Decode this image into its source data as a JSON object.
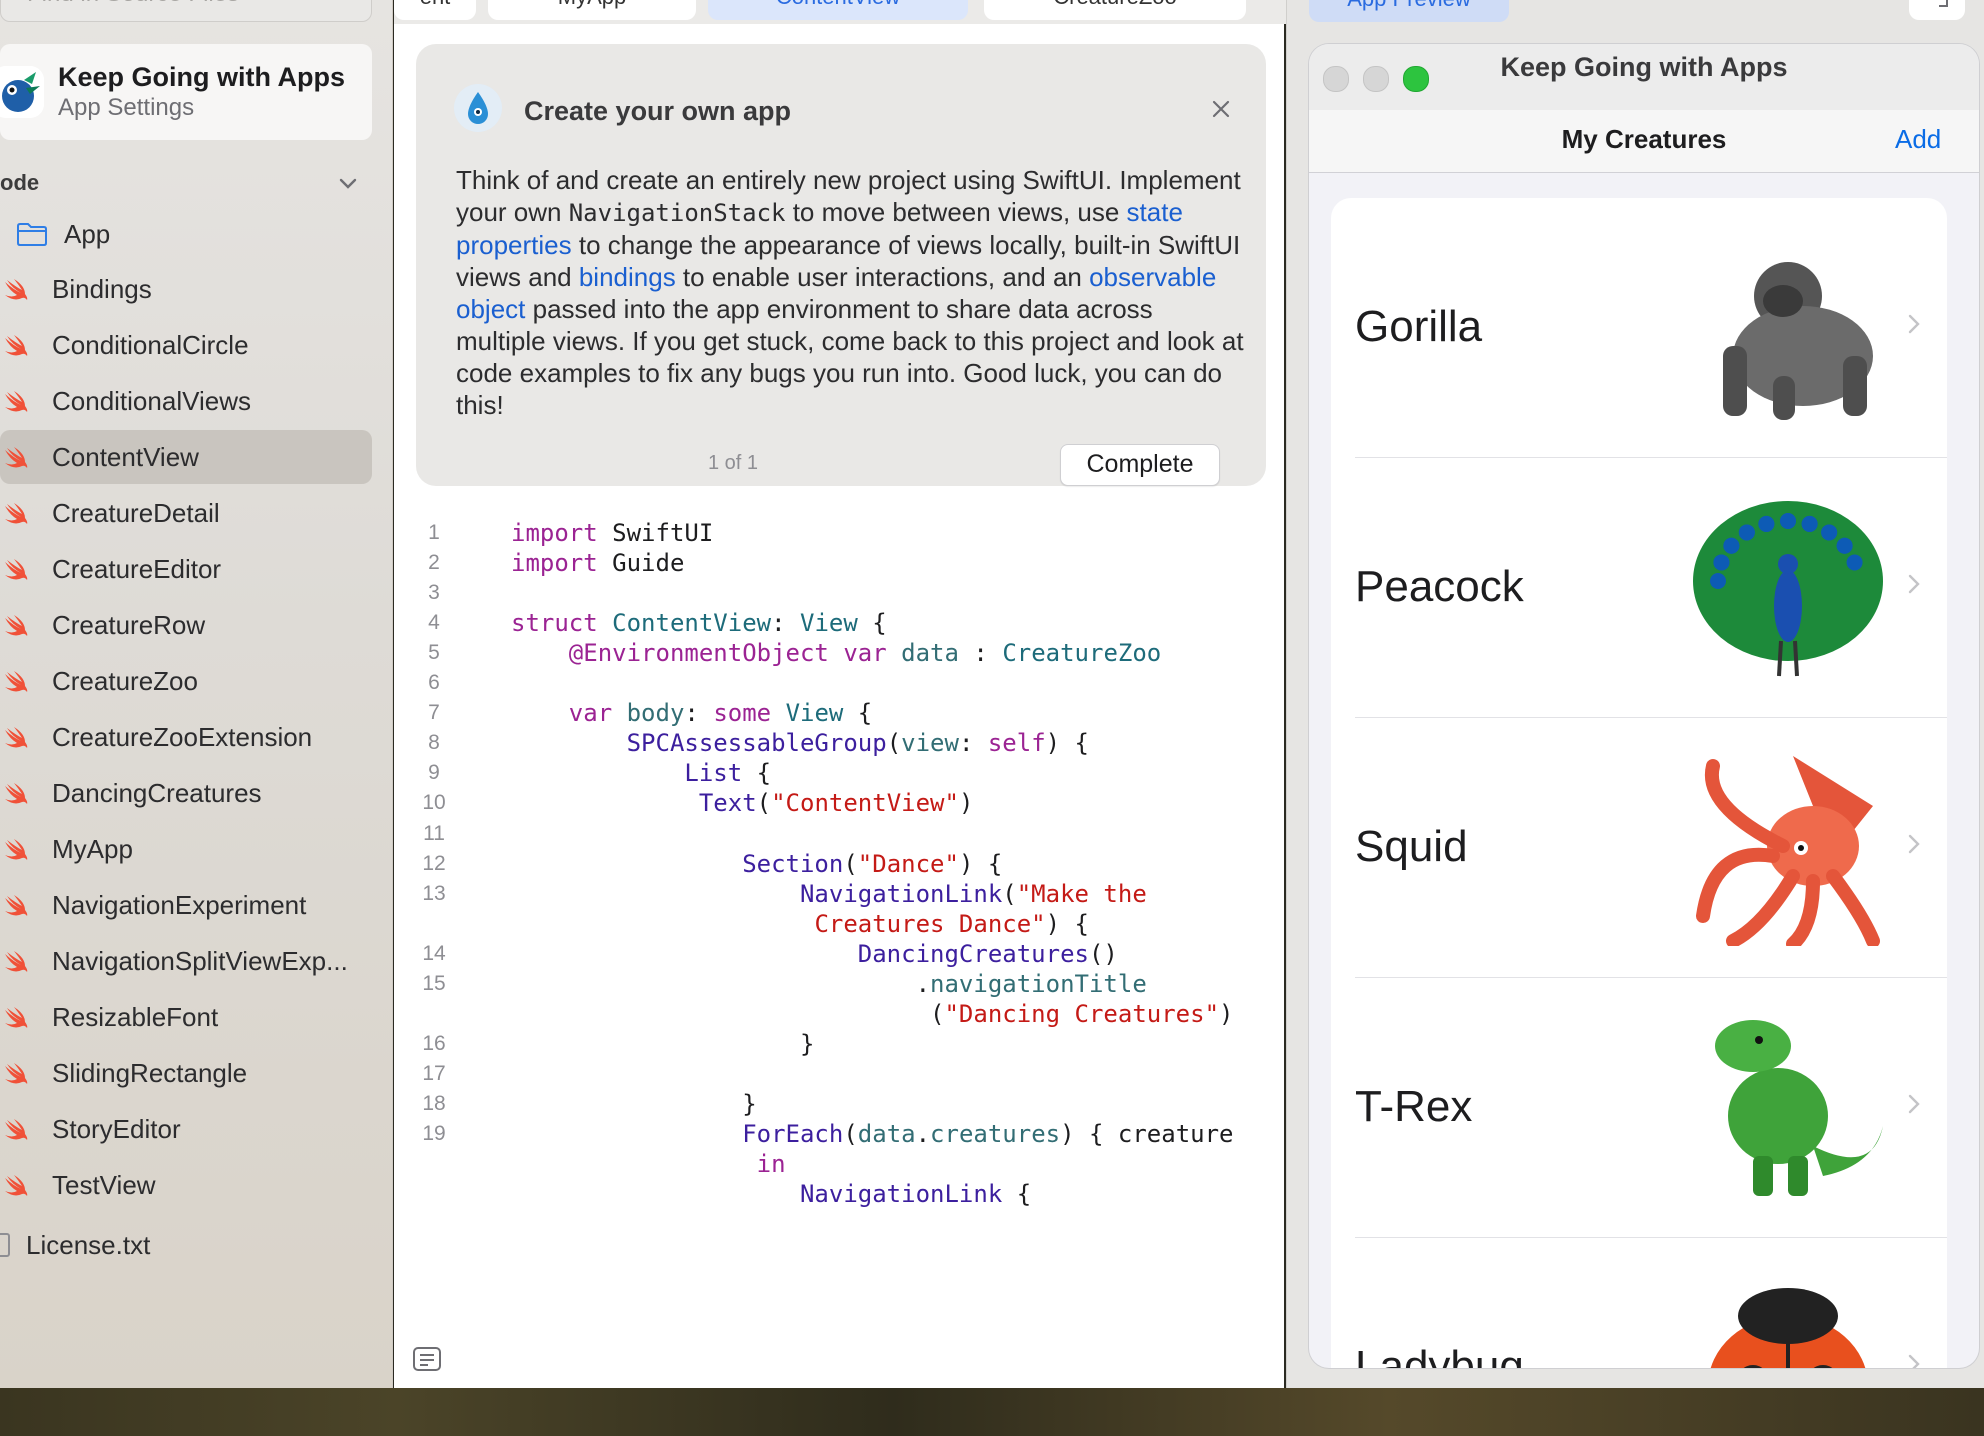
{
  "sidebar": {
    "search_placeholder": "Find in Source Files",
    "project": {
      "title": "Keep Going with Apps",
      "subtitle": "App Settings"
    },
    "section_title": "ode",
    "folder": "App",
    "files": [
      "Bindings",
      "ConditionalCircle",
      "ConditionalViews",
      "ContentView",
      "CreatureDetail",
      "CreatureEditor",
      "CreatureRow",
      "CreatureZoo",
      "CreatureZooExtension",
      "DancingCreatures",
      "MyApp",
      "NavigationExperiment",
      "NavigationSplitViewExp...",
      "ResizableFont",
      "SlidingRectangle",
      "StoryEditor",
      "TestView"
    ],
    "selected_file": "ContentView",
    "license_file": "License.txt"
  },
  "tabs": [
    "ent",
    "MyApp",
    "ContentView",
    "CreatureZoo"
  ],
  "guide": {
    "title": "Create your own app",
    "body_1": "Think of and create an entirely new project using SwiftUI. Implement your own ",
    "body_code": "NavigationStack",
    "body_2": " to move between views, use ",
    "link_1": "state properties",
    "body_3": " to change the appearance of views locally, built-in SwiftUI views and ",
    "link_2": "bindings",
    "body_4": " to enable user interactions, and an ",
    "link_3": "observable object",
    "body_5": " passed into the app environment to share data across multiple views. If you get stuck, come back to this project and look at code examples to fix any bugs you run into. Good luck, you can do this!",
    "pager": "1 of 1",
    "complete_label": "Complete"
  },
  "code_lines": [
    {
      "n": "1",
      "t": "import SwiftUI"
    },
    {
      "n": "2",
      "t": "import Guide"
    },
    {
      "n": "3",
      "t": ""
    },
    {
      "n": "4",
      "t": "struct ContentView: View {"
    },
    {
      "n": "5",
      "t": "    @EnvironmentObject var data : CreatureZoo"
    },
    {
      "n": "6",
      "t": ""
    },
    {
      "n": "7",
      "t": "    var body: some View {"
    },
    {
      "n": "8",
      "t": "        SPCAssessableGroup(view: self) {"
    },
    {
      "n": "9",
      "t": "            List {"
    },
    {
      "n": "10",
      "t": "             Text(\"ContentView\")"
    },
    {
      "n": "11",
      "t": ""
    },
    {
      "n": "12",
      "t": "                Section(\"Dance\") {"
    },
    {
      "n": "13",
      "t": "                    NavigationLink(\"Make the"
    },
    {
      "n": "",
      "t": "                     Creatures Dance\") {"
    },
    {
      "n": "14",
      "t": "                        DancingCreatures()"
    },
    {
      "n": "15",
      "t": "                            .navigationTitle"
    },
    {
      "n": "",
      "t": "                             (\"Dancing Creatures\")"
    },
    {
      "n": "16",
      "t": "                    }"
    },
    {
      "n": "17",
      "t": ""
    },
    {
      "n": "18",
      "t": "                }"
    },
    {
      "n": "19",
      "t": "                ForEach(data.creatures) { creature"
    },
    {
      "n": "",
      "t": "                 in"
    },
    {
      "n": "",
      "t": "                    NavigationLink {"
    }
  ],
  "preview": {
    "tab_label": "App Preview",
    "window_title": "Keep Going with Apps",
    "nav_title": "My Creatures",
    "nav_add": "Add",
    "creatures": [
      {
        "name": "Gorilla",
        "emoji": "gorilla"
      },
      {
        "name": "Peacock",
        "emoji": "peacock"
      },
      {
        "name": "Squid",
        "emoji": "squid"
      },
      {
        "name": "T-Rex",
        "emoji": "t-rex"
      },
      {
        "name": "Ladybug",
        "emoji": "ladybug"
      }
    ]
  },
  "colors": {
    "accent": "#0a6ce6",
    "keyword": "#9b2393",
    "string": "#c41a16",
    "type": "#1d6b7a",
    "swift_icon": "#f05138"
  }
}
